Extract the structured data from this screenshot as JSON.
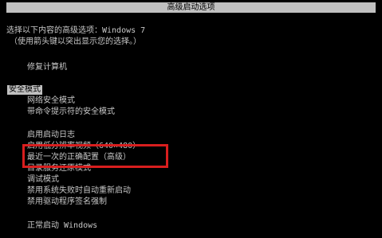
{
  "title": "高级启动选项",
  "instructions": {
    "line1": "选择以下内容的高级选项：Windows 7",
    "line2": "（使用箭头键以突出显示您的选择。）"
  },
  "options": {
    "repair": "修复计算机",
    "safe_mode": "安全模式",
    "safe_mode_network": "网络安全模式",
    "safe_mode_cmd": "带命令提示符的安全模式",
    "boot_logging": "启用启动日志",
    "low_res_video": "启用低分辨率视频（640×480）",
    "last_known_good": "最近一次的正确配置（高级）",
    "directory_restore": "目录服务还原模式",
    "debug_mode": "调试模式",
    "disable_auto_restart": "禁用系统失败时自动重新启动",
    "disable_driver_signing": "禁用驱动程序签名强制",
    "start_normally": "正常启动 Windows"
  },
  "selected_option": "safe_mode",
  "colors": {
    "background": "#000000",
    "text": "#c8c8c8",
    "title_bar": "#c0c0c0",
    "annotation_box": "#d81e1e"
  }
}
